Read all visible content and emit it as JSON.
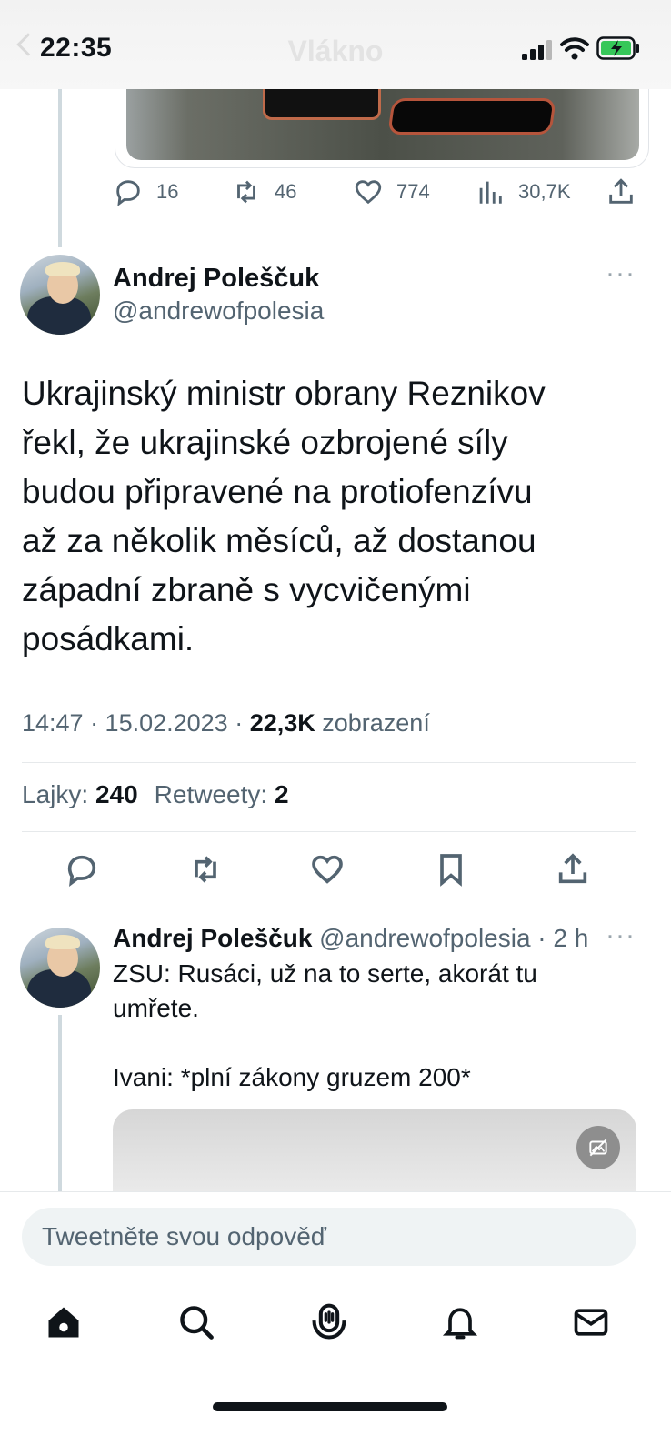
{
  "status_bar": {
    "time": "22:35",
    "ghost_title": "Vlákno"
  },
  "previous_tweet": {
    "actions": {
      "replies": "16",
      "retweets": "46",
      "likes": "774",
      "views": "30,7K"
    }
  },
  "main_tweet": {
    "author_name": "Andrej Polеščuk",
    "author_handle": "@andrewofpolesia",
    "more": "···",
    "text_lines": [
      "Ukrajinský ministr obrany Reznikov",
      "řekl, že ukrajinské ozbrojené síly",
      "budou připravené na protiofenzívu",
      "až za několik měsíců, až dostanou",
      "západní zbraně s vycvičenými",
      "posádkami."
    ],
    "timestamp": "14:47 · 15.02.2023 · ",
    "views_count": "22,3K",
    "views_label": " zobrazení",
    "likes_label": "Lajky: ",
    "likes_count": "240",
    "retweets_label": "Retweety: ",
    "retweets_count": "2"
  },
  "reply_tweet": {
    "author_name": "Andrej Polеščuk",
    "author_handle": " @andrewofpolesia · 2 h",
    "more": "···",
    "line1": "ZSU: Rusáci, už na to serte, akorát tu",
    "line2": "umřete.",
    "line3": "Ivani: *plní zákony gruzem 200*"
  },
  "composer": {
    "placeholder": "Tweetněte svou odpověď"
  },
  "tab_bar": {
    "items": [
      "home-icon",
      "search-icon",
      "spaces-icon",
      "notifications-icon",
      "messages-icon"
    ]
  }
}
